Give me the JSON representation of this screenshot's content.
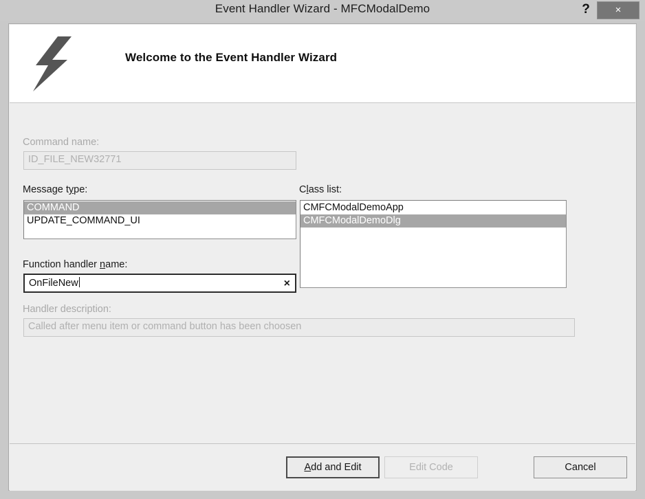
{
  "window": {
    "title": "Event Handler Wizard - MFCModalDemo",
    "help_button": "?",
    "close_button": "×"
  },
  "header": {
    "icon": "lightning-bolt-icon",
    "title": "Welcome to the Event Handler Wizard"
  },
  "fields": {
    "command_name": {
      "label": "Command name:",
      "value": "ID_FILE_NEW32771",
      "enabled": false
    },
    "message_type": {
      "label_before": "Message t",
      "label_accel": "y",
      "label_after": "pe:",
      "items": [
        {
          "text": "COMMAND",
          "selected": true
        },
        {
          "text": "UPDATE_COMMAND_UI",
          "selected": false
        }
      ]
    },
    "class_list": {
      "label_before": "C",
      "label_accel": "l",
      "label_after": "ass list:",
      "items": [
        {
          "text": "CMFCModalDemoApp",
          "selected": false
        },
        {
          "text": "CMFCModalDemoDlg",
          "selected": true
        }
      ]
    },
    "function_handler_name": {
      "label_before": "Function handler ",
      "label_accel": "n",
      "label_after": "ame:",
      "value": "OnFileNew",
      "clear_icon": "×",
      "enabled": true
    },
    "handler_description": {
      "label": "Handler description:",
      "value": "Called after menu item or command button has been choosen",
      "enabled": false
    }
  },
  "footer": {
    "add_and_edit": {
      "accel": "A",
      "rest": "dd and Edit",
      "enabled": true,
      "default": true
    },
    "edit_code": {
      "accel": "E",
      "rest": "dit Code",
      "enabled": false,
      "default": false
    },
    "cancel": {
      "label": "Cancel",
      "enabled": true,
      "default": false
    }
  },
  "colors": {
    "dialog_background": "#eeeeee",
    "frame": "#c9c9c9",
    "header_background": "#ffffff",
    "selection": "#a6a6a6",
    "close_button": "#767676",
    "icon": "#555555",
    "disabled_text": "#b0b0b0"
  }
}
